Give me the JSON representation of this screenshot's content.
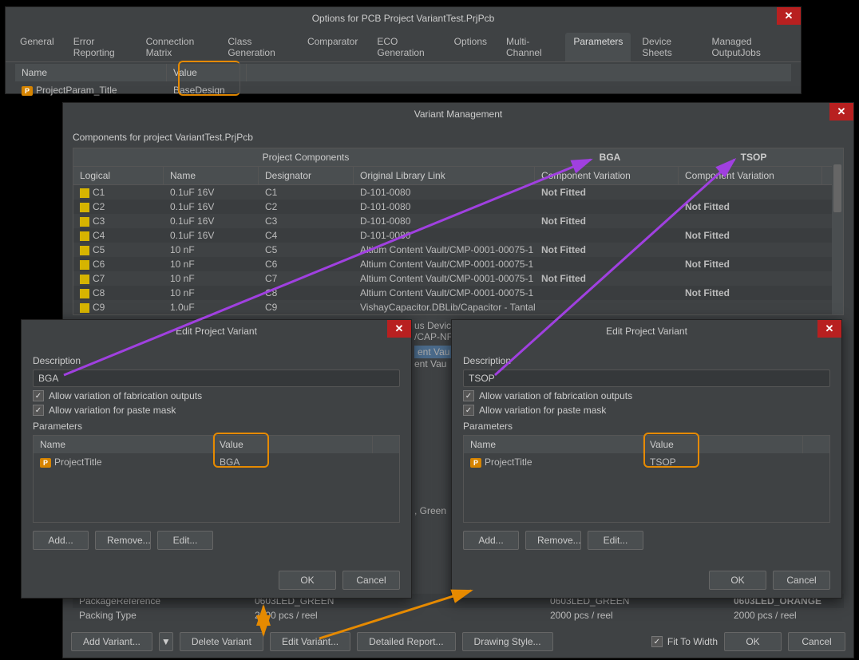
{
  "options_window": {
    "title": "Options for PCB Project VariantTest.PrjPcb",
    "tabs": [
      "General",
      "Error Reporting",
      "Connection Matrix",
      "Class Generation",
      "Comparator",
      "ECO Generation",
      "Options",
      "Multi-Channel",
      "Parameters",
      "Device Sheets",
      "Managed OutputJobs"
    ],
    "active_tab": 8,
    "grid": {
      "col_name": "Name",
      "col_value": "Value",
      "row_name": "ProjectParam_Title",
      "row_value": "BaseDesign"
    }
  },
  "variant_mgmt": {
    "title": "Variant Management",
    "subtitle": "Components for project VariantTest.PrjPcb",
    "top_headers": {
      "proj": "Project Components",
      "bga": "BGA",
      "tsop": "TSOP"
    },
    "cols": {
      "logical": "Logical",
      "name": "Name",
      "designator": "Designator",
      "lib": "Original Library Link",
      "var1": "Component Variation",
      "var2": "Component Variation"
    },
    "rows": [
      {
        "logical": "C1",
        "name": "0.1uF 16V",
        "designator": "C1",
        "lib": "D-101-0080",
        "var1": "Not Fitted",
        "var2": ""
      },
      {
        "logical": "C2",
        "name": "0.1uF 16V",
        "designator": "C2",
        "lib": "D-101-0080",
        "var1": "",
        "var2": "Not Fitted"
      },
      {
        "logical": "C3",
        "name": "0.1uF 16V",
        "designator": "C3",
        "lib": "D-101-0080",
        "var1": "Not Fitted",
        "var2": ""
      },
      {
        "logical": "C4",
        "name": "0.1uF 16V",
        "designator": "C4",
        "lib": "D-101-0080",
        "var1": "",
        "var2": "Not Fitted"
      },
      {
        "logical": "C5",
        "name": "10 nF",
        "designator": "C5",
        "lib": "Altium Content Vault/CMP-0001-00075-1",
        "var1": "Not Fitted",
        "var2": ""
      },
      {
        "logical": "C6",
        "name": "10 nF",
        "designator": "C6",
        "lib": "Altium Content Vault/CMP-0001-00075-1",
        "var1": "",
        "var2": "Not Fitted"
      },
      {
        "logical": "C7",
        "name": "10 nF",
        "designator": "C7",
        "lib": "Altium Content Vault/CMP-0001-00075-1",
        "var1": "Not Fitted",
        "var2": ""
      },
      {
        "logical": "C8",
        "name": "10 nF",
        "designator": "C8",
        "lib": "Altium Content Vault/CMP-0001-00075-1",
        "var1": "",
        "var2": "Not Fitted"
      },
      {
        "logical": "C9",
        "name": "1.0uF",
        "designator": "C9",
        "lib": "VishayCapacitor.DBLib/Capacitor - Tantalum",
        "var1": "",
        "var2": ""
      }
    ],
    "bg_text1": "us Devic",
    "bg_text2": "/CAP-NF",
    "bg_text3": "ent Vau",
    "bg_text4": "ent Vau",
    "bg_text5": ", Green",
    "footer_rows": [
      {
        "label": "PackageReference",
        "val1": "0603LED_GREEN",
        "val2": "0603LED_GREEN",
        "val3": "0603LED_ORANGE"
      },
      {
        "label": "Packing Type",
        "val1": "2000 pcs / reel",
        "val2": "2000 pcs / reel",
        "val3": "2000 pcs / reel"
      }
    ],
    "buttons": {
      "add_variant": "Add Variant...",
      "delete_variant": "Delete Variant",
      "edit_variant": "Edit Variant...",
      "detailed_report": "Detailed Report...",
      "drawing_style": "Drawing Style...",
      "fit": "Fit To Width",
      "ok": "OK",
      "cancel": "Cancel"
    }
  },
  "edit_variant_left": {
    "title": "Edit Project Variant",
    "desc_label": "Description",
    "desc_value": "BGA",
    "allow_fab": "Allow variation of fabrication outputs",
    "allow_paste": "Allow variation for paste mask",
    "params_label": "Parameters",
    "col_name": "Name",
    "col_value": "Value",
    "param_name": "ProjectTitle",
    "param_value": "BGA",
    "add": "Add...",
    "remove": "Remove...",
    "edit": "Edit...",
    "ok": "OK",
    "cancel": "Cancel"
  },
  "edit_variant_right": {
    "title": "Edit Project Variant",
    "desc_label": "Description",
    "desc_value": "TSOP",
    "allow_fab": "Allow variation of fabrication outputs",
    "allow_paste": "Allow variation for paste mask",
    "params_label": "Parameters",
    "col_name": "Name",
    "col_value": "Value",
    "param_name": "ProjectTitle",
    "param_value": "TSOP",
    "add": "Add...",
    "remove": "Remove...",
    "edit": "Edit...",
    "ok": "OK",
    "cancel": "Cancel"
  }
}
